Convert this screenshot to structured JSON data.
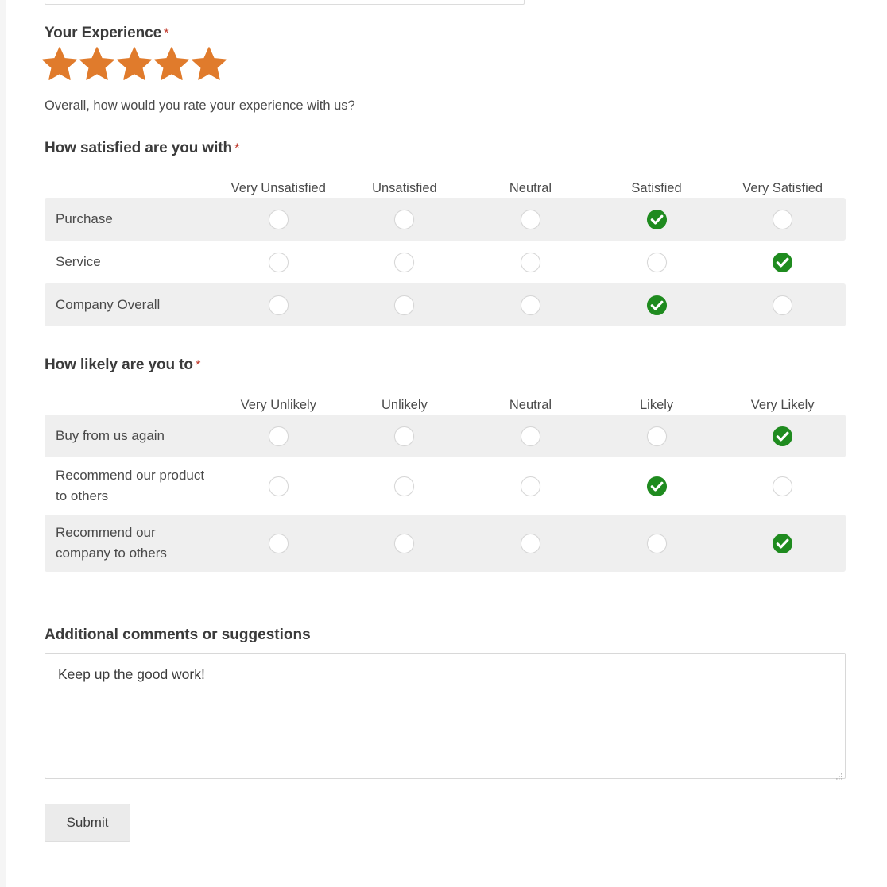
{
  "form": {
    "star_rating": {
      "title": "Your Experience",
      "required_marker": "*",
      "help_text": "Overall, how would you rate your experience with us?",
      "stars_total": 5,
      "stars_filled": 5,
      "star_color": "#E07B2C",
      "icon": "star-icon"
    },
    "satisfaction_matrix": {
      "title": "How satisfied are you with",
      "required_marker": "*",
      "columns": [
        "Very Unsatisfied",
        "Unsatisfied",
        "Neutral",
        "Satisfied",
        "Very Satisfied"
      ],
      "rows": [
        {
          "label": "Purchase",
          "selected_index": 3,
          "selected_label": "Satisfied"
        },
        {
          "label": "Service",
          "selected_index": 4,
          "selected_label": "Very Satisfied"
        },
        {
          "label": "Company Overall",
          "selected_index": 3,
          "selected_label": "Satisfied"
        }
      ]
    },
    "likelihood_matrix": {
      "title": "How likely are you to",
      "required_marker": "*",
      "columns": [
        "Very Unlikely",
        "Unlikely",
        "Neutral",
        "Likely",
        "Very Likely"
      ],
      "rows": [
        {
          "label": "Buy from us again",
          "selected_index": 4,
          "selected_label": "Very Likely"
        },
        {
          "label": "Recommend our product to others",
          "selected_index": 3,
          "selected_label": "Likely"
        },
        {
          "label": "Recommend our company to others",
          "selected_index": 4,
          "selected_label": "Very Likely"
        }
      ]
    },
    "comments": {
      "label": "Additional comments or suggestions",
      "value": "Keep up the good work!",
      "placeholder": ""
    },
    "submit": {
      "label": "Submit"
    }
  },
  "colors": {
    "selected_green": "#1F8B1F",
    "star_orange": "#E07B2C",
    "required_red": "#C0392B",
    "row_alt_band": "#EFEFEF",
    "heading_text": "#3B3B3B",
    "body_text": "#4A4A4A"
  }
}
